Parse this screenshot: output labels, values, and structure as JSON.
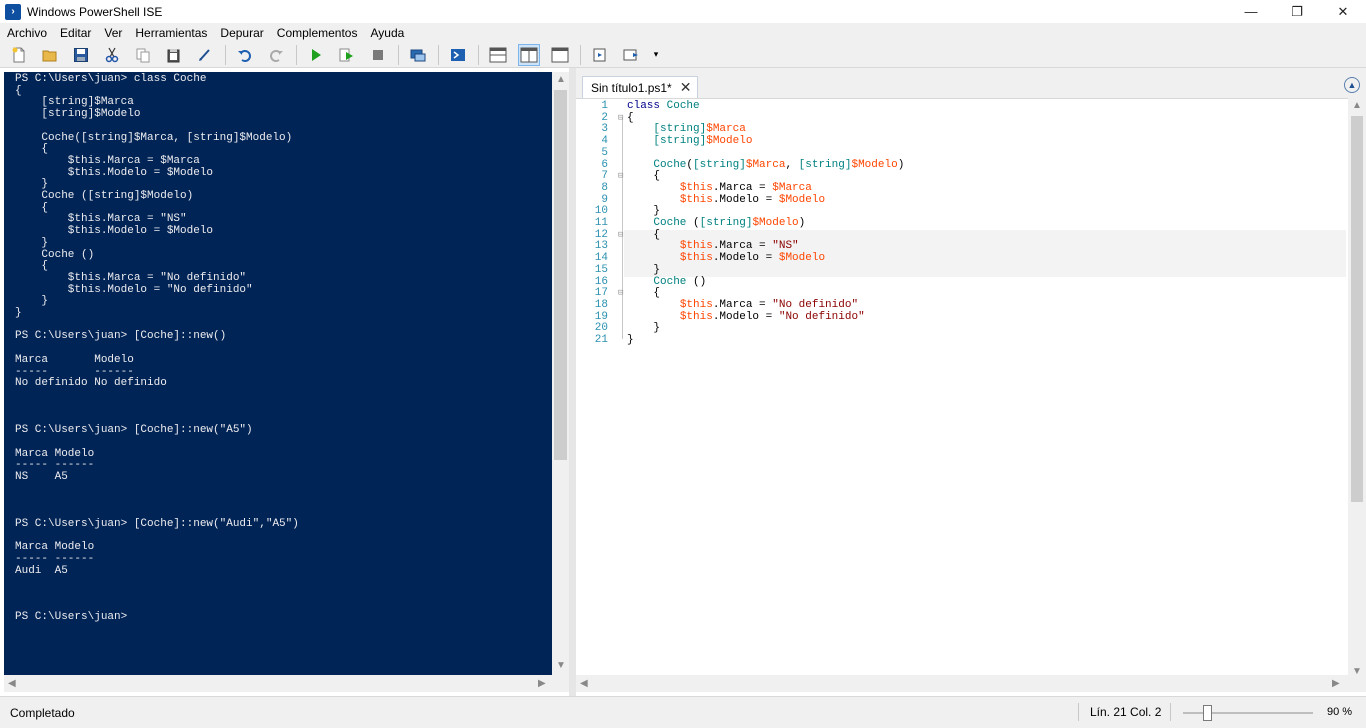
{
  "window": {
    "title": "Windows PowerShell ISE",
    "minimize": "—",
    "restore": "❐",
    "close": "✕"
  },
  "menu": [
    "Archivo",
    "Editar",
    "Ver",
    "Herramientas",
    "Depurar",
    "Complementos",
    "Ayuda"
  ],
  "toolbar_icons": [
    "new-file-icon",
    "open-folder-icon",
    "save-icon",
    "cut-icon",
    "copy-icon",
    "paste-icon",
    "clear-console-icon",
    "undo-icon",
    "redo-icon",
    "run-icon",
    "run-selection-icon",
    "stop-icon",
    "remote-tab-icon",
    "powershell-icon",
    "layout-top-icon",
    "layout-right-icon",
    "layout-max-icon",
    "snippets-icon",
    "commands-icon"
  ],
  "console": {
    "text": "PS C:\\Users\\juan> class Coche\n{\n    [string]$Marca\n    [string]$Modelo\n\n    Coche([string]$Marca, [string]$Modelo)\n    {\n        $this.Marca = $Marca\n        $this.Modelo = $Modelo\n    }\n    Coche ([string]$Modelo)\n    {\n        $this.Marca = \"NS\"\n        $this.Modelo = $Modelo\n    }\n    Coche ()\n    {\n        $this.Marca = \"No definido\"\n        $this.Modelo = \"No definido\"\n    }\n}\n\nPS C:\\Users\\juan> [Coche]::new()\n\nMarca       Modelo\n-----       ------\nNo definido No definido\n\n\n\nPS C:\\Users\\juan> [Coche]::new(\"A5\")\n\nMarca Modelo\n----- ------\nNS    A5\n\n\n\nPS C:\\Users\\juan> [Coche]::new(\"Audi\",\"A5\")\n\nMarca Modelo\n----- ------\nAudi  A5\n\n\n\nPS C:\\Users\\juan>"
  },
  "editor": {
    "tab_label": "Sin título1.ps1*",
    "tab_close": "✕",
    "line_numbers": [
      "1",
      "2",
      "3",
      "4",
      "5",
      "6",
      "7",
      "8",
      "9",
      "10",
      "11",
      "12",
      "13",
      "14",
      "15",
      "16",
      "17",
      "18",
      "19",
      "20",
      "21"
    ],
    "code_lines": [
      "class Coche",
      "{",
      "    [string]$Marca",
      "    [string]$Modelo",
      "",
      "    Coche([string]$Marca, [string]$Modelo)",
      "    {",
      "        $this.Marca = $Marca",
      "        $this.Modelo = $Modelo",
      "    }",
      "    Coche ([string]$Modelo)",
      "    {",
      "        $this.Marca = \"NS\"",
      "        $this.Modelo = $Modelo",
      "    }",
      "    Coche ()",
      "    {",
      "        $this.Marca = \"No definido\"",
      "        $this.Modelo = \"No definido\"",
      "    }",
      "}"
    ]
  },
  "status": {
    "text": "Completado",
    "position": "Lín. 21  Col. 2",
    "zoom": "90 %",
    "zoom_level_percent": 90
  },
  "colors": {
    "console_bg": "#012456",
    "console_fg": "#eeedf0",
    "keyword": "#00008b",
    "type": "#008080",
    "variable": "#ff4500",
    "string": "#8b0000",
    "line_number": "#2b91af"
  }
}
